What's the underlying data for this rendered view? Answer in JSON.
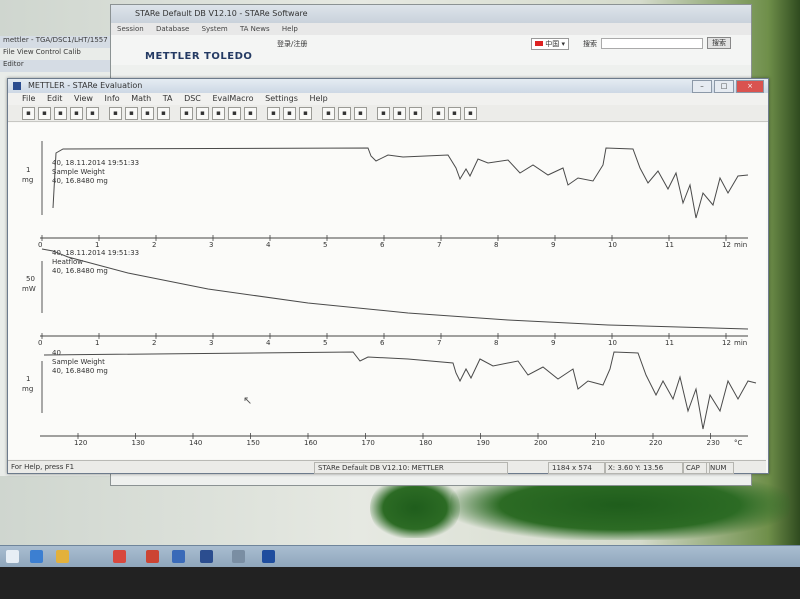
{
  "bg_left": {
    "rows": [
      "mettler - TGA/DSC1/LHT/1557",
      "File  View  Control  Calib",
      "Editor"
    ]
  },
  "bg_window": {
    "title": "STARe Default DB V12.10 - STARe Software",
    "title_fragment": "M",
    "menu": [
      "Session",
      "Database",
      "System",
      "TA News",
      "Help"
    ],
    "login_label": "登录/注册",
    "lang_select": "中国",
    "search_label": "搜索",
    "search_button": "搜索",
    "logo": "METTLER  TOLEDO"
  },
  "eval_window": {
    "title": "METTLER - STARe Evaluation",
    "menu": [
      "File",
      "Edit",
      "View",
      "Info",
      "Math",
      "TA",
      "DSC",
      "EvalMacro",
      "Settings",
      "Help"
    ],
    "toolbar_icons": [
      "new-icon",
      "open-icon",
      "save-icon",
      "print-icon",
      "layout-icon",
      "sep",
      "curve-icon",
      "copy-icon",
      "paste-icon",
      "scale-icon",
      "sep",
      "cut-icon",
      "zoom-icon",
      "table-icon",
      "undo-icon",
      "redo-icon",
      "sep",
      "fill-icon",
      "grid-icon",
      "text-icon",
      "sep",
      "zoom-in-icon",
      "zoom-out-icon",
      "zoom-fit-icon",
      "sep",
      "axis-icon",
      "line-icon",
      "bar-icon",
      "sep",
      "info-icon",
      "help-icon",
      "macro-icon"
    ]
  },
  "plots": {
    "panel1": {
      "scale_value": "1",
      "scale_unit": "mg",
      "legend": [
        "40, 18.11.2014 19:51:33",
        "Sample Weight",
        "40, 16.8480 mg"
      ],
      "axis_ticks": [
        "0",
        "1",
        "2",
        "3",
        "4",
        "5",
        "6",
        "7",
        "8",
        "9",
        "10",
        "11",
        "12"
      ],
      "axis_unit": "min"
    },
    "panel2": {
      "scale_value": "50",
      "scale_unit": "mW",
      "legend": [
        "40, 18.11.2014 19:51:33",
        "Heatflow",
        "40, 16.8480 mg"
      ],
      "axis_ticks": [
        "0",
        "1",
        "2",
        "3",
        "4",
        "5",
        "6",
        "7",
        "8",
        "9",
        "10",
        "11",
        "12"
      ],
      "axis_unit": "min"
    },
    "panel3": {
      "scale_value": "1",
      "scale_unit": "mg",
      "legend": [
        "40",
        "Sample Weight",
        "40, 16.8480 mg"
      ],
      "axis_ticks": [
        "120",
        "130",
        "140",
        "150",
        "160",
        "170",
        "180",
        "190",
        "200",
        "210",
        "220",
        "230"
      ],
      "axis_unit": "°C"
    }
  },
  "statusbar": {
    "help": "For Help, press F1",
    "db": "STARe Default DB V12.10: METTLER",
    "size": "1184 x 574",
    "coords": "X: 3.60 Y: 13.56",
    "cap": "CAP",
    "num": "NUM"
  },
  "taskbar": {
    "icons": [
      "explorer-icon",
      "ie-icon",
      "folder-icon",
      "chrome-icon",
      "badge-app-icon",
      "program-icon",
      "stare-icon",
      "window-icon",
      "stare-eval-icon"
    ]
  },
  "colors": {
    "title_bar": "#cdd8e5",
    "plot_line": "#4a4a4a",
    "close_button": "#d9534f",
    "taskbar": "#9db2c6"
  }
}
